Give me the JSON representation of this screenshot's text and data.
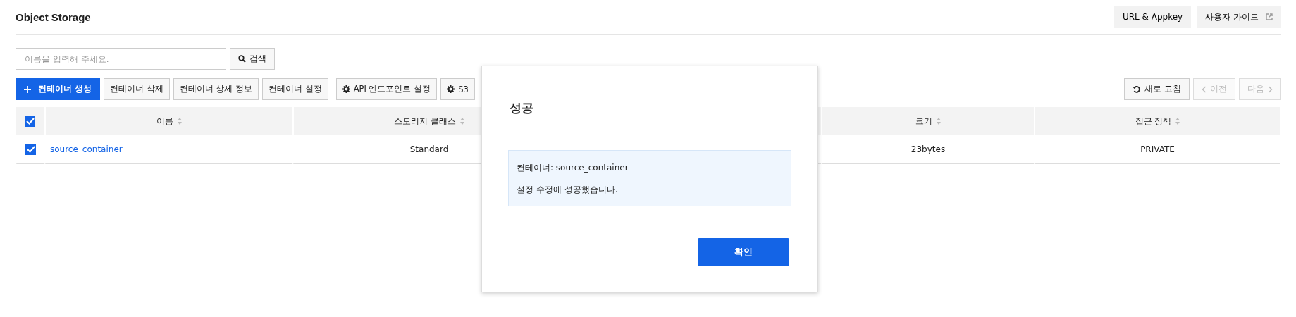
{
  "header": {
    "title": "Object Storage",
    "buttons": [
      {
        "label": "URL & Appkey",
        "kind": "plain"
      },
      {
        "label": "사용자 가이드",
        "kind": "external"
      }
    ]
  },
  "search": {
    "placeholder": "이름을 입력해 주세요.",
    "button": "검색"
  },
  "toolbar": {
    "left": [
      {
        "label": "컨테이너 생성",
        "kind": "primary"
      },
      {
        "label": "컨테이너 삭제",
        "kind": "plain"
      },
      {
        "label": "컨테이너 상세 정보",
        "kind": "plain"
      },
      {
        "label": "컨테이너 설정",
        "kind": "plain"
      },
      {
        "label": "API 엔드포인트 설정",
        "kind": "gear"
      },
      {
        "label": "S3",
        "kind": "gear"
      }
    ],
    "right": [
      {
        "label": "새로 고침",
        "kind": "refresh",
        "disabled": false
      },
      {
        "label": "이전",
        "kind": "prev",
        "disabled": true
      },
      {
        "label": "다음",
        "kind": "next",
        "disabled": true
      }
    ]
  },
  "table": {
    "all_checked": true,
    "columns": [
      "이름",
      "스토리지 클래스",
      "크기",
      "접근 정책"
    ],
    "rows": [
      {
        "checked": true,
        "name": "source_container",
        "storage_class": "Standard",
        "size": "23bytes",
        "access_policy": "PRIVATE"
      }
    ]
  },
  "dialog": {
    "title": "성공",
    "lines": [
      "컨테이너: source_container",
      "설정 수정에 성공했습니다."
    ],
    "button": "확인"
  }
}
